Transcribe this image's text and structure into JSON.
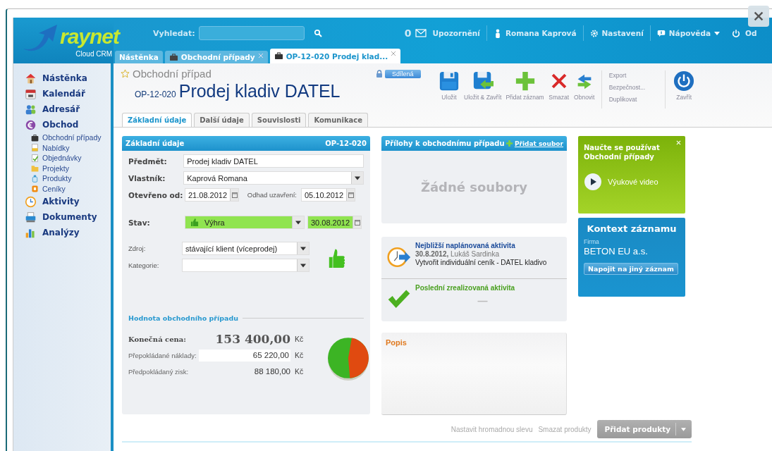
{
  "header": {
    "logo": {
      "name": "raynet",
      "subtitle": "Cloud CRM"
    },
    "search": {
      "label": "Vyhledat:"
    },
    "notifications": {
      "count": "0",
      "label": "Upozornění"
    },
    "user": "Romana Kaprová",
    "settings": "Nastavení",
    "help": "Nápověda",
    "logout": "Od"
  },
  "tabs": [
    {
      "label": "Nástěnka",
      "selected": false,
      "closable": false,
      "briefcase": false
    },
    {
      "label": "Obchodní případy",
      "selected": false,
      "closable": true,
      "briefcase": true
    },
    {
      "label": "OP-12-020 Prodej klad...",
      "selected": true,
      "closable": true,
      "briefcase": true
    }
  ],
  "sidebar": {
    "items": [
      {
        "label": "Nástěnka"
      },
      {
        "label": "Kalendář"
      },
      {
        "label": "Adresář"
      },
      {
        "label": "Obchod",
        "children": [
          {
            "label": "Obchodní případy"
          },
          {
            "label": "Nabídky"
          },
          {
            "label": "Objednávky"
          },
          {
            "label": "Projekty"
          },
          {
            "label": "Produkty"
          },
          {
            "label": "Ceníky"
          }
        ]
      },
      {
        "label": "Aktivity"
      },
      {
        "label": "Dokumenty"
      },
      {
        "label": "Analýzy"
      }
    ]
  },
  "record": {
    "type": "Obchodní případ",
    "code": "OP-12-020",
    "title": "Prodej kladiv DATEL",
    "favorite": false,
    "locked": true,
    "sharing": "Sdílená"
  },
  "toolbar": {
    "actions": [
      {
        "label": "Uložit"
      },
      {
        "label": "Uložit & Zavřít"
      },
      {
        "label": "Přidat záznam"
      },
      {
        "label": "Smazat"
      },
      {
        "label": "Obnovit"
      }
    ],
    "links": [
      "Export",
      "Bezpečnost...",
      "Duplikovat"
    ],
    "close": "Zavřít"
  },
  "subtabs": [
    {
      "label": "Základní údaje",
      "selected": true
    },
    {
      "label": "Další údaje",
      "selected": false
    },
    {
      "label": "Souvislosti",
      "selected": false
    },
    {
      "label": "Komunikace",
      "selected": false
    }
  ],
  "form": {
    "title": "Základní údaje",
    "code": "OP-12-020",
    "subject": {
      "label": "Předmět:",
      "value": "Prodej kladiv DATEL"
    },
    "owner": {
      "label": "Vlastník:",
      "value": "Kaprová Romana"
    },
    "opened": {
      "label": "Otevřeno od:",
      "value": "21.08.2012"
    },
    "estimate": {
      "label": "Odhad uzavření:",
      "value": "05.10.2012"
    },
    "status": {
      "label": "Stav:",
      "value": "Výhra",
      "date": "30.08.2012",
      "won": true
    },
    "source": {
      "label": "Zdroj:",
      "value": "stávající klient (víceprodej)"
    },
    "category": {
      "label": "Kategorie:"
    },
    "value_section": {
      "title": "Hodnota obchodního případu",
      "rows": [
        {
          "kind": "total",
          "label": "Konečná cena:",
          "value": "153 400,00",
          "currency": "Kč"
        },
        {
          "kind": "input",
          "label": "Přepokládané náklady:",
          "value": "65 220,00",
          "currency": "Kč"
        },
        {
          "kind": "plain",
          "label": "Předpokládaný zisk:",
          "value": "88 180,00",
          "currency": "Kč"
        }
      ]
    }
  },
  "attachments": {
    "title": "Přílohy k obchodnímu případu",
    "add": "Přidat soubor",
    "empty": "Žádné soubory"
  },
  "activities": {
    "next": {
      "title": "Nejbližší naplánovaná aktivita",
      "date": "30.8.2012,",
      "person": "Lukáš Sardinka",
      "subject": "Vytvořit individuální ceník - DATEL kladivo"
    },
    "last": {
      "title": "Poslední zrealizovaná aktivita",
      "value": "—"
    }
  },
  "description": {
    "title": "Popis"
  },
  "tutorial": {
    "title": "Naučte se používat Obchodní případy",
    "video": "Výukové video"
  },
  "context": {
    "title": "Kontext záznamu",
    "type_label": "Firma",
    "name": "BETON EU a.s.",
    "button": "Napojit na jiný záznam"
  },
  "products": {
    "links": [
      "Nastavit hromadnou slevu",
      "Smazat produkty"
    ],
    "button": "Přidat produkty"
  }
}
